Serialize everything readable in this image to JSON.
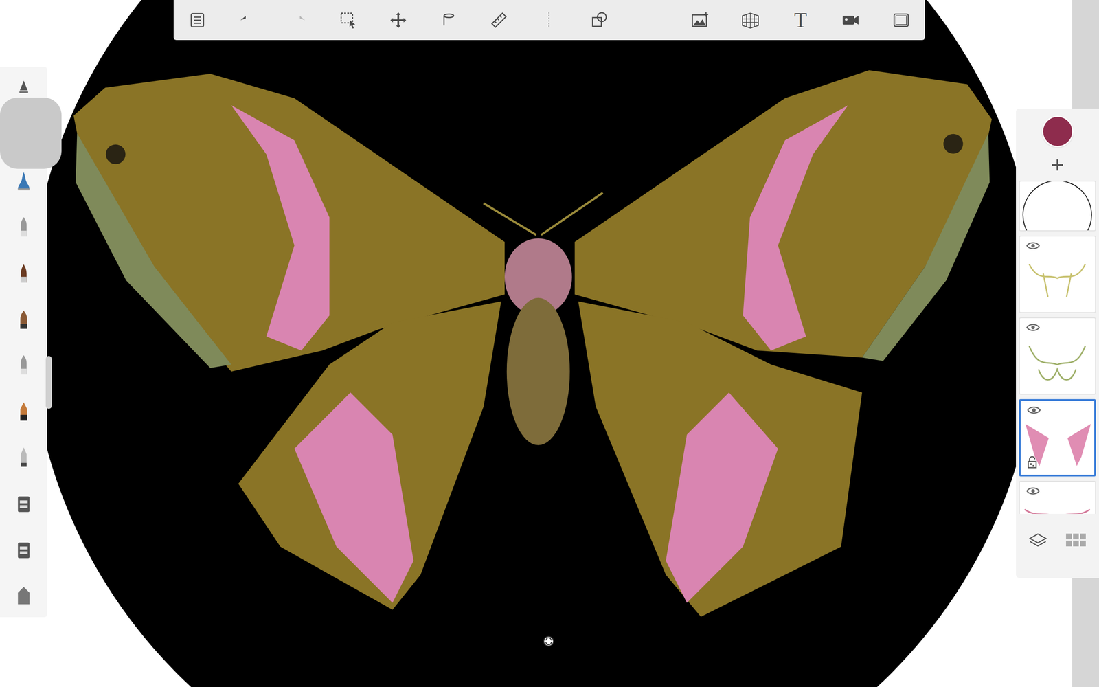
{
  "toolbar": {
    "tools": [
      {
        "kind": "list",
        "enabled": true
      },
      {
        "kind": "undo",
        "enabled": true
      },
      {
        "kind": "redo",
        "enabled": false
      },
      {
        "kind": "select",
        "enabled": true
      },
      {
        "kind": "move",
        "enabled": true
      },
      {
        "kind": "fill",
        "enabled": true
      },
      {
        "kind": "ruler",
        "enabled": true
      },
      {
        "kind": "symmetry",
        "enabled": true
      },
      {
        "kind": "shapes",
        "enabled": true
      },
      {
        "kind": "curve",
        "enabled": true
      },
      {
        "kind": "image",
        "enabled": true
      },
      {
        "kind": "perspective",
        "enabled": true
      },
      {
        "kind": "text",
        "label": "T",
        "enabled": true
      },
      {
        "kind": "video",
        "enabled": true
      },
      {
        "kind": "fullscreen",
        "enabled": true
      }
    ]
  },
  "brushes": [
    {
      "kind": "cone"
    },
    {
      "kind": "pencil"
    },
    {
      "kind": "bell"
    },
    {
      "kind": "pen"
    },
    {
      "kind": "brush"
    },
    {
      "kind": "paint"
    },
    {
      "kind": "pen"
    },
    {
      "kind": "marker"
    },
    {
      "kind": "chisel"
    },
    {
      "kind": "jar"
    },
    {
      "kind": "jar"
    },
    {
      "kind": "eraser"
    }
  ],
  "current_color": "#8e2c4d",
  "layers_panel": {
    "add_label": "+",
    "layers": [
      {
        "kind": "circle",
        "selected": false,
        "locked": false
      },
      {
        "kind": "yellow-lines",
        "visible": true,
        "selected": false,
        "locked": false
      },
      {
        "kind": "green-lines",
        "visible": true,
        "selected": false,
        "locked": false
      },
      {
        "kind": "pink",
        "visible": true,
        "selected": true,
        "locked": true
      },
      {
        "kind": "pink-lines",
        "visible": true,
        "selected": false,
        "locked": false
      }
    ]
  }
}
